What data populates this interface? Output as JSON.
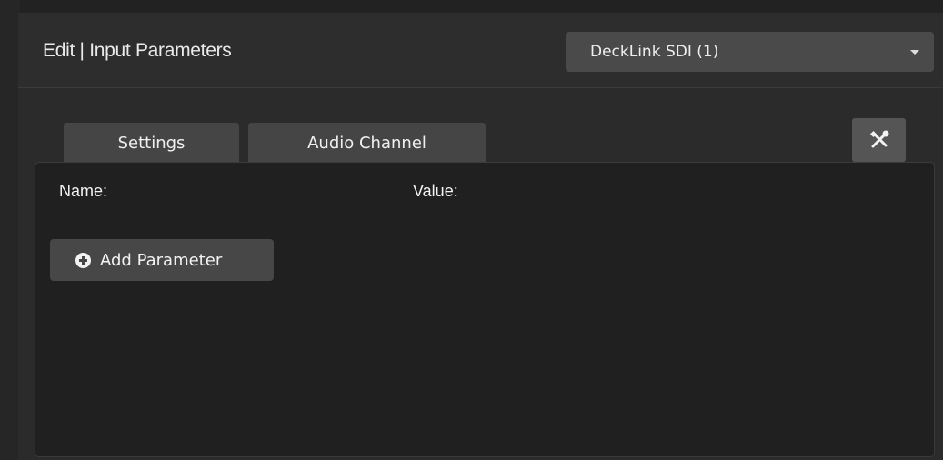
{
  "header": {
    "title": "Edit | Input Parameters",
    "device_select": {
      "selected": "DeckLink SDI (1)"
    }
  },
  "tabs": [
    {
      "label": "Settings",
      "active": true
    },
    {
      "label": "Audio Channel",
      "active": false
    }
  ],
  "tools_button": {
    "icon": "tools-icon"
  },
  "panel": {
    "name_label": "Name:",
    "value_label": "Value:",
    "add_button": {
      "label": "Add Parameter",
      "icon": "plus-circle-icon"
    }
  },
  "colors": {
    "background": "#2b2b2b",
    "panel": "#202020",
    "tab": "#454545",
    "button": "#474747",
    "text": "#f0f0f0"
  }
}
